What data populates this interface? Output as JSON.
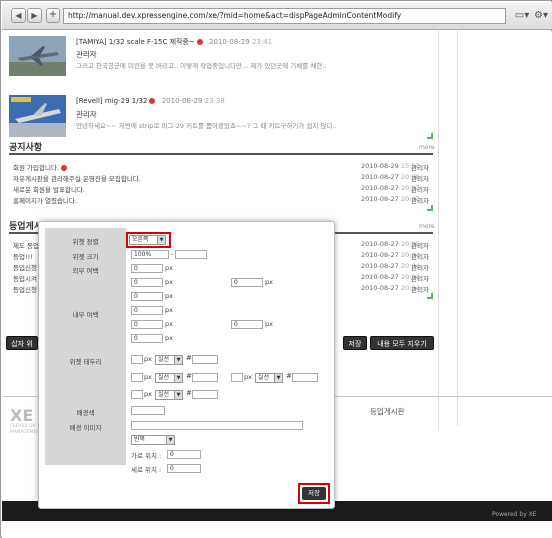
{
  "browser": {
    "url": "http://manual.dev.xpressengine.com/xe/?mid=home&act=dispPageAdminContentModify",
    "back_glyph": "◀",
    "forward_glyph": "▶",
    "add_glyph": "+",
    "page_menu_glyph": "▭▾",
    "tools_glyph": "⚙▾"
  },
  "news": [
    {
      "title": "[TAMIYA] 1/32 scale F-15C 제작중~",
      "date": "2010-08-29",
      "time": "23:41",
      "author": "관리자",
      "summary": "그리고 한국공군에 미련을 못 버리고.. 이렇게 작업중입니다만... 제가 있던곳에 기체를 채현.."
    },
    {
      "title": "[Revell] mig-29 1/32",
      "date": "2010-08-29",
      "time": "23:38",
      "author": "관리자",
      "summary": "안녕하세요~~ 저번에 strip로 미그-29 키트를 뽑아봤었죠~~? 그 때 키트구하기가 쉽지 않다.."
    }
  ],
  "notice": {
    "title": "공지사항",
    "more": "more",
    "rows": [
      {
        "text": "회원 가입합니다.",
        "date": "2010-08-29",
        "time": "15:57",
        "author": "관리자"
      },
      {
        "text": "자유게시판을 관리해주실 운영진을 모집합니다.",
        "date": "2010-08-27",
        "time": "20:08",
        "author": "관리자"
      },
      {
        "text": "새로운 회원을 발표합니다.",
        "date": "2010-08-27",
        "time": "20:07",
        "author": "관리자"
      },
      {
        "text": "홈페이지가 열렸습니다.",
        "date": "2010-08-27",
        "time": "20:07",
        "author": "관리자"
      }
    ]
  },
  "signup": {
    "title": "등업게시판",
    "more": "more",
    "rows": [
      {
        "text": "제도 등업",
        "date": "2010-08-27",
        "time": "20:05",
        "author": "관리자"
      },
      {
        "text": "등업!!!",
        "date": "2010-08-27",
        "time": "20:04",
        "author": "관리자"
      },
      {
        "text": "등업신청",
        "date": "2010-08-27",
        "time": "20:04",
        "author": "관리자"
      },
      {
        "text": "등업시켜",
        "date": "2010-08-27",
        "time": "20:04",
        "author": "관리자"
      },
      {
        "text": "등업신청",
        "date": "2010-08-27",
        "time": "20:04",
        "author": "관리자"
      }
    ]
  },
  "page_buttons": {
    "insert": "삽자 위",
    "save": "저장",
    "clear_all": "내용 모두 지우기"
  },
  "footer": {
    "logo": "XE",
    "logo_sub1": "CLEVER OR",
    "logo_sub2": "MANAGEMEN",
    "link": "등업게시판",
    "powered": "Powered by XE"
  },
  "widget_form": {
    "position_label": "위젯 정렬",
    "position_value": "오른쪽",
    "size_label": "위젯 크기",
    "size_width": "100%",
    "size_sep": "-",
    "outer_margin_label": "외부 여백",
    "inner_margin_label": "내부 여백",
    "border_label": "위젯 테두리",
    "bg_color_label": "배경색",
    "bg_image_label": "배경 이미지",
    "px": "px",
    "zero": "0",
    "border_style": "실선",
    "hash": "#",
    "repeat_value": "반복",
    "x_pos_label": "가로 위치 :",
    "y_pos_label": "세로 위치 :",
    "save_label": "저장"
  }
}
